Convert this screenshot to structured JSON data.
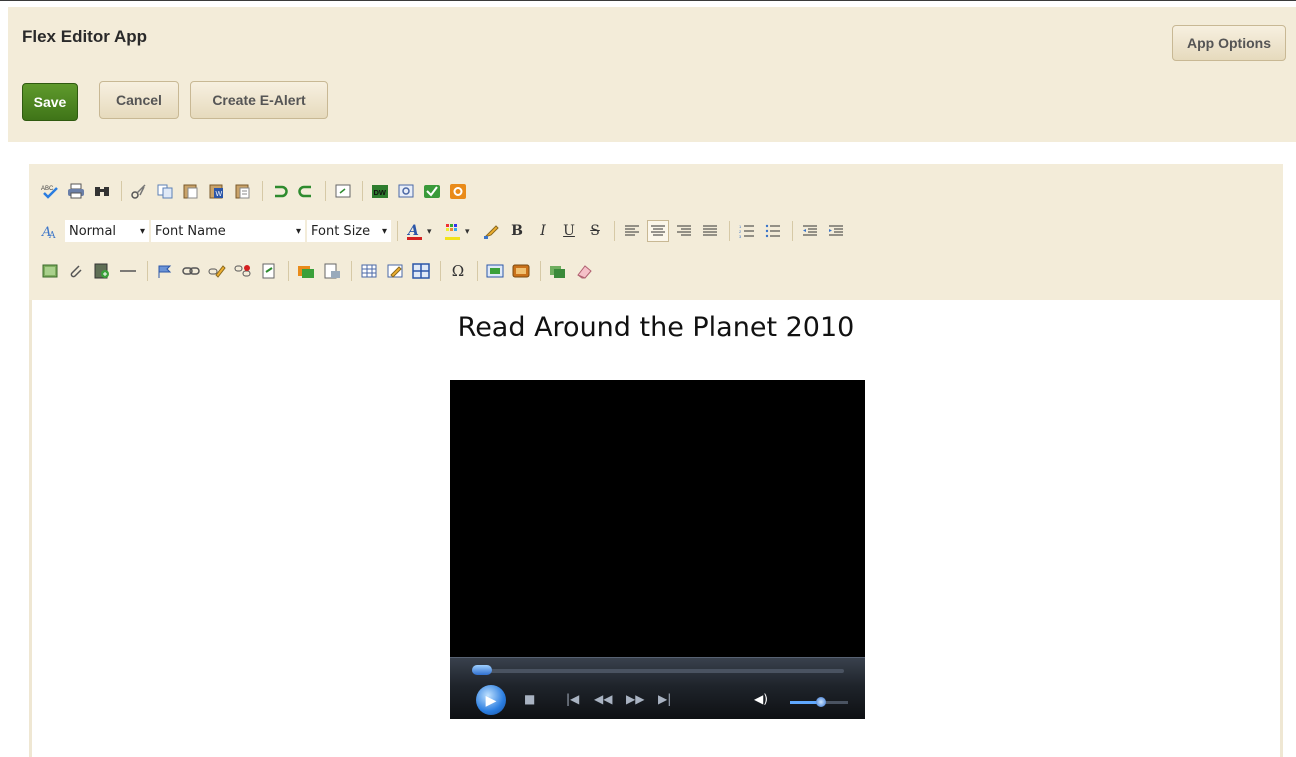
{
  "app": {
    "title": "Flex Editor App"
  },
  "header": {
    "save_label": "Save",
    "cancel_label": "Cancel",
    "ealert_label": "Create E-Alert",
    "app_options_label": "App Options"
  },
  "toolbar": {
    "format_value": "Normal",
    "font_name_value": "Font Name",
    "font_size_value": "Font Size",
    "bold_label": "B",
    "italic_label": "I",
    "underline_label": "U",
    "strike_label": "S",
    "omega_label": "Ω"
  },
  "editor": {
    "heading": "Read Around the Planet 2010"
  },
  "colors": {
    "header_bg": "#f3ecd9",
    "save_green": "#4a8421",
    "player_blue": "#2a7de0"
  }
}
